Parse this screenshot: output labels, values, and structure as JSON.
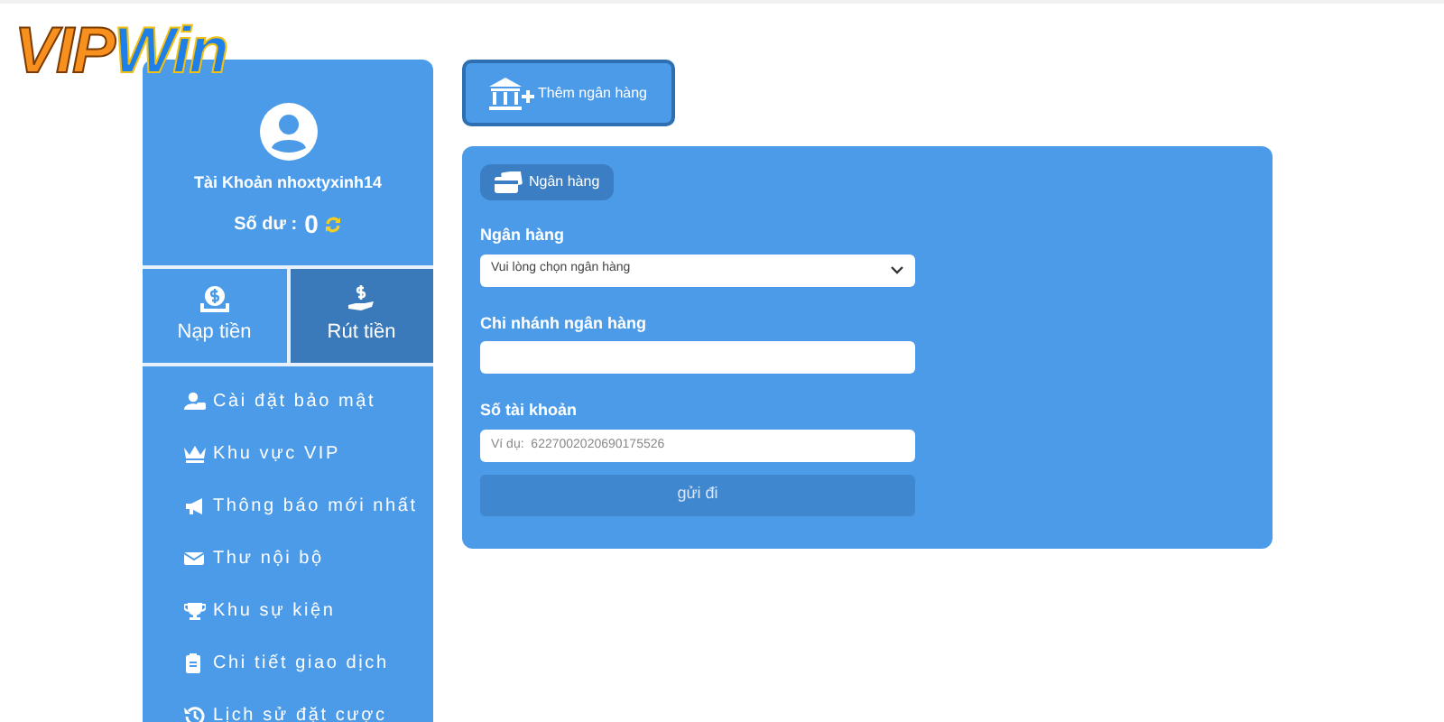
{
  "logo": [
    {
      "text": "VIP",
      "kind": "warm"
    },
    {
      "text": "Win",
      "kind": "cool"
    }
  ],
  "profile": {
    "account": "Tài Khoản nhoxtyxinh14",
    "balance_label": "Số dư :",
    "balance": "0"
  },
  "actions": [
    {
      "label": "Nạp tiền",
      "kind": "deposit",
      "selected": false
    },
    {
      "label": "Rút tiền",
      "kind": "withdraw",
      "selected": true
    }
  ],
  "menu": [
    {
      "label": "Cài đặt bảo mật",
      "kind": "security"
    },
    {
      "label": "Khu vực VIP",
      "kind": "vip"
    },
    {
      "label": "Thông báo mới nhất",
      "kind": "news"
    },
    {
      "label": "Thư nội bộ",
      "kind": "mail"
    },
    {
      "label": "Khu sự kiện",
      "kind": "event"
    },
    {
      "label": "Chi tiết giao dịch",
      "kind": "detail"
    },
    {
      "label": "Lịch sử đặt cược",
      "kind": "history"
    }
  ],
  "add_bank_button": "Thêm ngân hàng",
  "panel": {
    "tab": "Ngân hàng",
    "fields": [
      {
        "label": "Ngân hàng",
        "kind": "select",
        "value": "Vui lòng chọn ngân hàng"
      },
      {
        "label": "Chi nhánh ngân hàng",
        "kind": "text"
      },
      {
        "label": "Số tài khoản",
        "kind": "text",
        "placeholder": "Ví dụ:  6227002020690175526"
      }
    ],
    "submit": "gửi đi"
  }
}
